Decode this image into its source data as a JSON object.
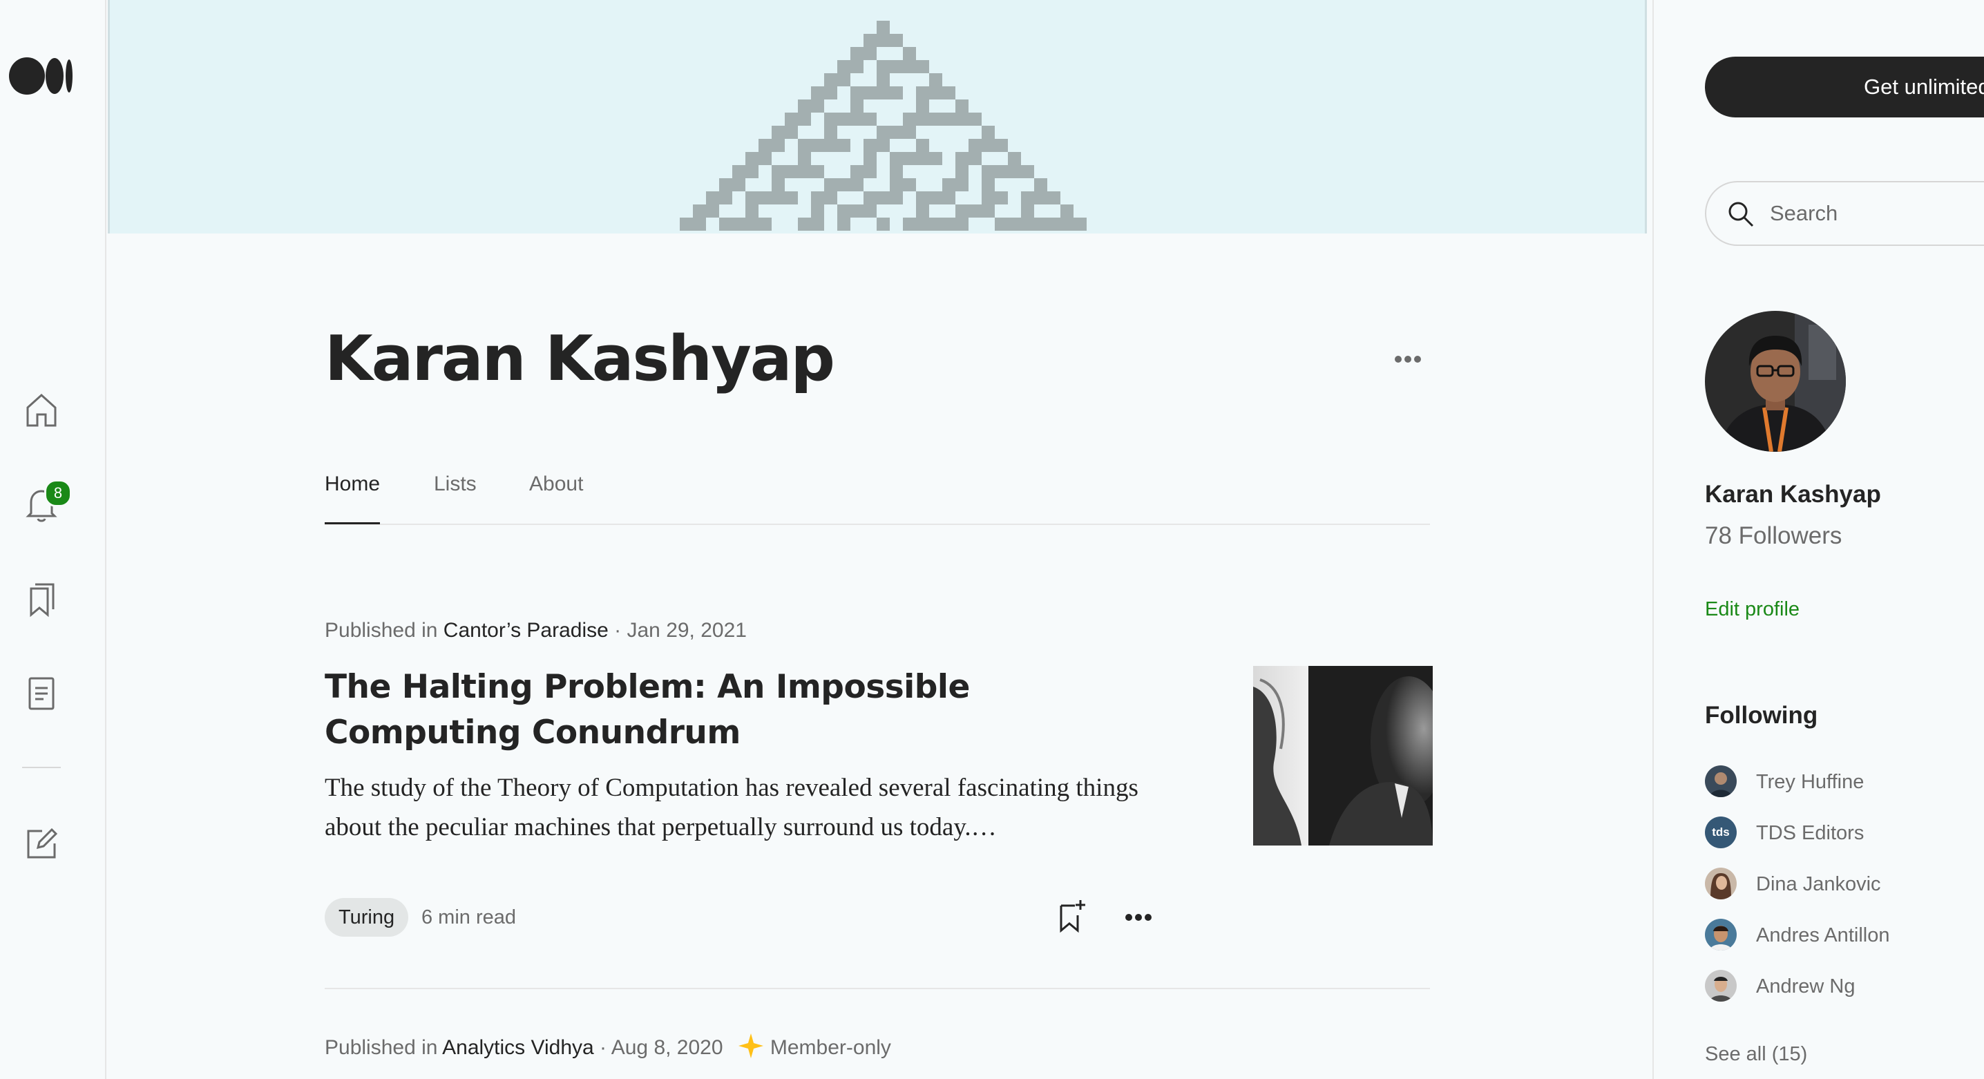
{
  "nav": {
    "notifications_count": "8"
  },
  "profile": {
    "name": "Karan Kashyap",
    "tabs": [
      "Home",
      "Lists",
      "About"
    ]
  },
  "articles": [
    {
      "published_prefix": "Published in",
      "publication": "Cantor’s Paradise",
      "date_sep": " · Jan 29, 2021",
      "title": "The Halting Problem: An Impossible Computing Conundrum",
      "subtitle": "The study of the Theory of Computation has revealed several fascinating things about the peculiar machines that perpetually surround us today.…",
      "tag": "Turing",
      "read_time": "6 min read"
    },
    {
      "published_prefix": "Published in",
      "publication": "Analytics Vidhya",
      "date_sep": " · Aug 8, 2020",
      "member_only": "Member-only"
    }
  ],
  "sidebar": {
    "cta_label": "Get unlimited access",
    "search_placeholder": "Search",
    "name": "Karan Kashyap",
    "followers": "78 Followers",
    "edit_profile": "Edit profile",
    "following_heading": "Following",
    "following": [
      {
        "name": "Trey Huffine",
        "avatar_color": "#3a4a5a"
      },
      {
        "name": "TDS Editors",
        "avatar_color": "#355876",
        "avatar_text": "tds"
      },
      {
        "name": "Dina Jankovic",
        "avatar_color": "#8a6a5a"
      },
      {
        "name": "Andres Antillon",
        "avatar_color": "#4a7a9a"
      },
      {
        "name": "Andrew Ng",
        "avatar_color": "#9a9a9a"
      }
    ],
    "see_all": "See all (15)"
  },
  "colors": {
    "accent_green": "#1a8917",
    "text_primary": "#242424",
    "text_secondary": "#6b6b6b",
    "banner_bg": "#e3f4f7"
  }
}
